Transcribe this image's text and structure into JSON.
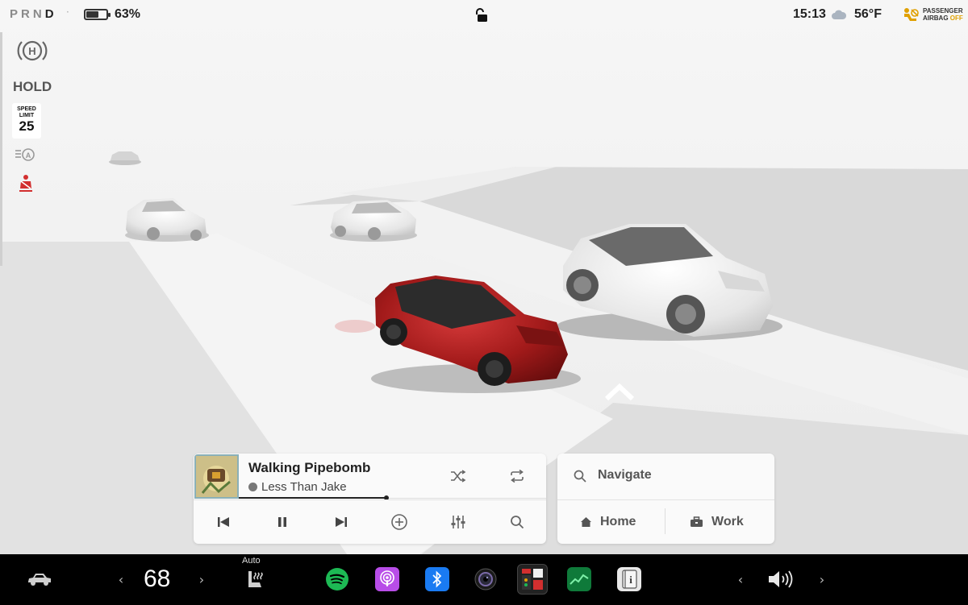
{
  "status_bar": {
    "gear_letters": [
      "P",
      "R",
      "N",
      "D"
    ],
    "active_gear": "D",
    "battery_percent_text": "63%",
    "battery_level": 0.63,
    "lock_state_icon": "unlock-icon",
    "time": "15:13",
    "weather_icon": "cloud-icon",
    "temperature": "56°F",
    "airbag_line1": "PASSENGER",
    "airbag_line2_prefix": "AIRBAG",
    "airbag_line2_status": "OFF"
  },
  "left_panel": {
    "hold_label": "HOLD",
    "speed_limit_label_1": "SPEED",
    "speed_limit_label_2": "LIMIT",
    "speed_limit_value": "25",
    "icons": [
      "hold-brake-icon",
      "auto-high-beam-icon",
      "seatbelt-warning-icon"
    ]
  },
  "media": {
    "track_title": "Walking Pipebomb",
    "artist": "Less Than Jake",
    "progress": 0.48,
    "buttons": [
      "shuffle-icon",
      "repeat-icon",
      "previous-icon",
      "pause-icon",
      "next-icon",
      "add-icon",
      "equalizer-icon",
      "search-icon"
    ]
  },
  "navigation": {
    "search_placeholder": "Navigate",
    "home_label": "Home",
    "work_label": "Work"
  },
  "dock": {
    "cabin_temperature": "68",
    "seat_heater_mode": "Auto",
    "apps": [
      "spotify-icon",
      "podcasts-icon",
      "bluetooth-icon",
      "camera-icon",
      "toybox-icon",
      "stocks-icon",
      "manual-icon"
    ],
    "volume_icon": "volume-icon"
  },
  "colors": {
    "accent_red": "#d22f2f",
    "airbag_off": "#e0a000",
    "spotify_green": "#1db954",
    "podcasts_purple": "#b84de8",
    "bluetooth_blue": "#1a7bf2",
    "dock_background": "#000000"
  }
}
